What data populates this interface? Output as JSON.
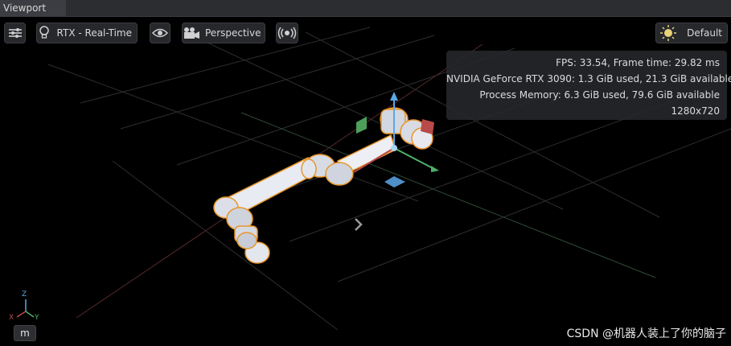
{
  "tab": {
    "title": "Viewport"
  },
  "toolbar": {
    "renderer_label": "RTX - Real-Time",
    "camera_label": "Perspective",
    "lighting_label": "Default"
  },
  "stats": {
    "fps_line": "FPS: 33.54, Frame time: 29.82 ms",
    "gpu_line": "NVIDIA GeForce RTX 3090: 1.3 GiB used, 21.3 GiB available",
    "memory_line": "Process Memory: 6.3 GiB used, 79.6 GiB available",
    "resolution_line": "1280x720"
  },
  "axes": {
    "z": "Z",
    "x": "X",
    "y": "Y"
  },
  "unit_label": "m",
  "watermark": "CSDN @机器人装上了你的脑子",
  "colors": {
    "selection_outline": "#e8962a",
    "axis_x": "#c04848",
    "axis_y": "#4fb06a",
    "axis_z": "#5aa7e6",
    "grid": "#3a3a3a"
  },
  "icons": [
    "settings-sliders-icon",
    "lightbulb-icon",
    "eye-icon",
    "movie-camera-icon",
    "broadcast-icon",
    "sun-icon",
    "chevron-right-icon"
  ]
}
